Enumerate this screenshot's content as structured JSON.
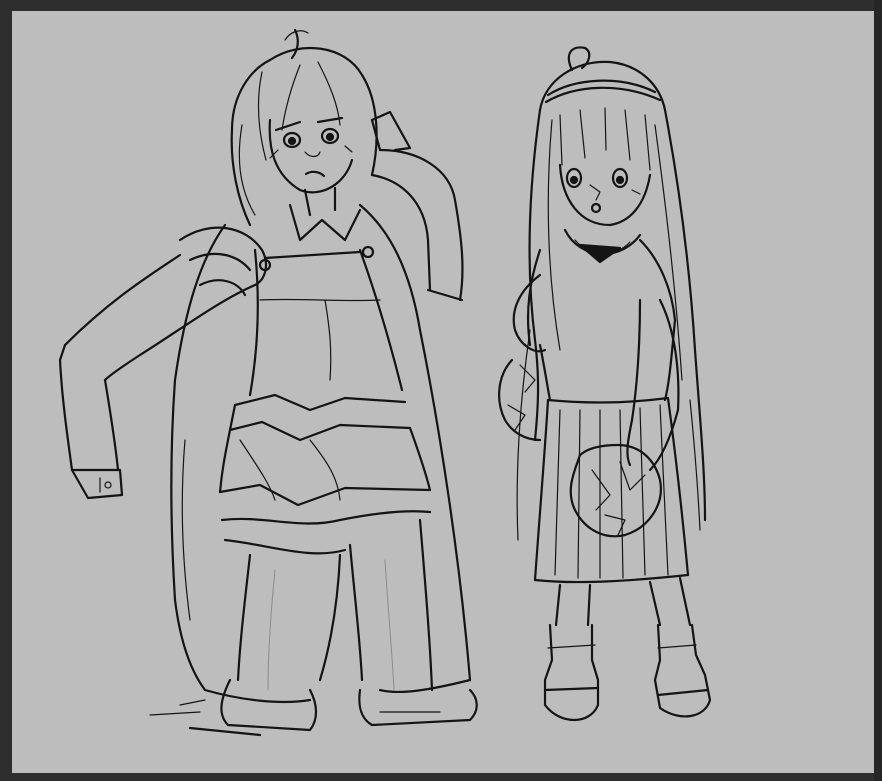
{
  "app": {
    "canvas_color": "#bdbdbd",
    "frame_color": "#2e2e2e",
    "line_color": "#141414"
  },
  "artwork": {
    "figures": [
      {
        "id": "knight",
        "icon": "knight-sketch"
      },
      {
        "id": "girl",
        "icon": "cheerleader-sketch"
      }
    ]
  }
}
